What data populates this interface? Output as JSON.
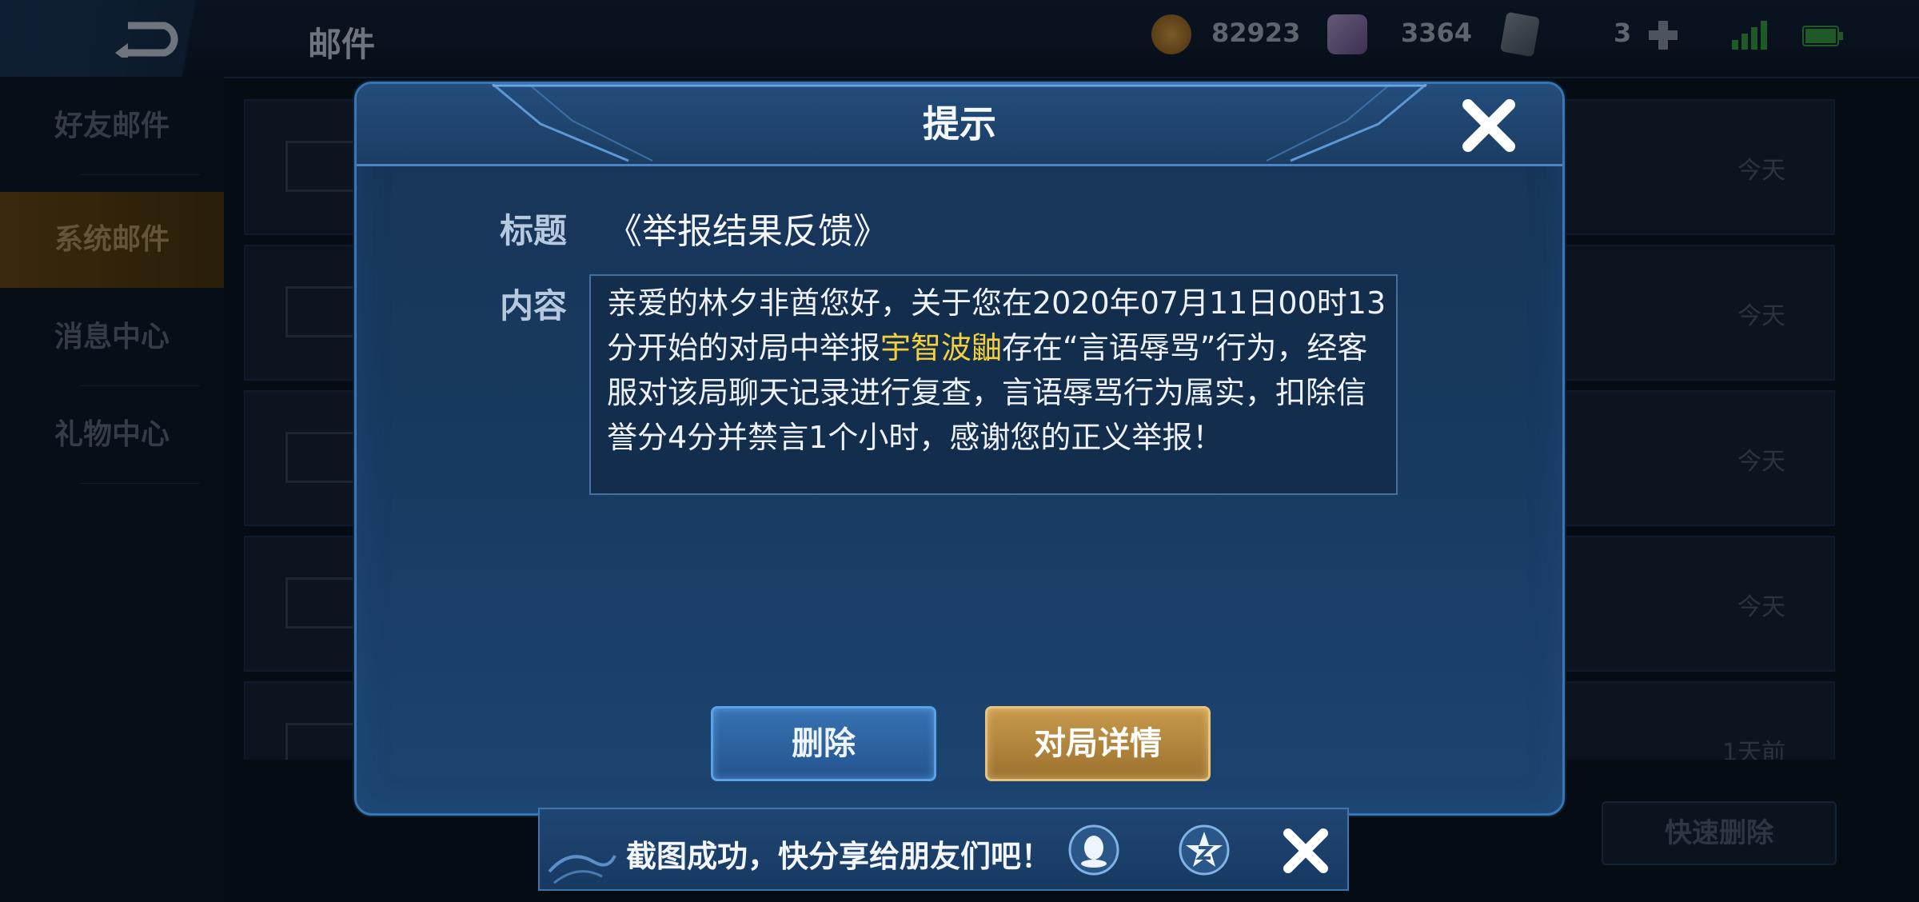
{
  "topbar": {
    "page_title": "邮件",
    "gold": "82923",
    "diamonds": "3364",
    "cards": "3"
  },
  "sidebar": {
    "items": [
      {
        "label": "好友邮件"
      },
      {
        "label": "系统邮件"
      },
      {
        "label": "消息中心"
      },
      {
        "label": "礼物中心"
      }
    ],
    "active_index": 1
  },
  "mail_list": {
    "rows": [
      {
        "date": "今天"
      },
      {
        "date": "今天"
      },
      {
        "date": "今天"
      },
      {
        "date": "今天"
      },
      {
        "date": "1天前"
      }
    ],
    "quick_delete": "快速删除"
  },
  "dialog": {
    "title": "提示",
    "subject_label": "标题",
    "subject_value": "《举报结果反馈》",
    "content_label": "内容",
    "content_before": "亲爱的林夕非酋您好，关于您在2020年07月11日00时13分开始的对局中举报",
    "content_highlight": "宇智波鼬",
    "content_after": "存在“言语辱骂”行为，经客服对该局聊天记录进行复查，言语辱骂行为属实，扣除信誉分4分并禁言1个小时，感谢您的正义举报！",
    "delete_label": "删除",
    "detail_label": "对局详情"
  },
  "toast": {
    "text": "截图成功，快分享给朋友们吧！"
  },
  "colors": {
    "highlight": "#f4cf3c",
    "gold_button": "#c79a4c",
    "blue_button": "#3872b2"
  }
}
